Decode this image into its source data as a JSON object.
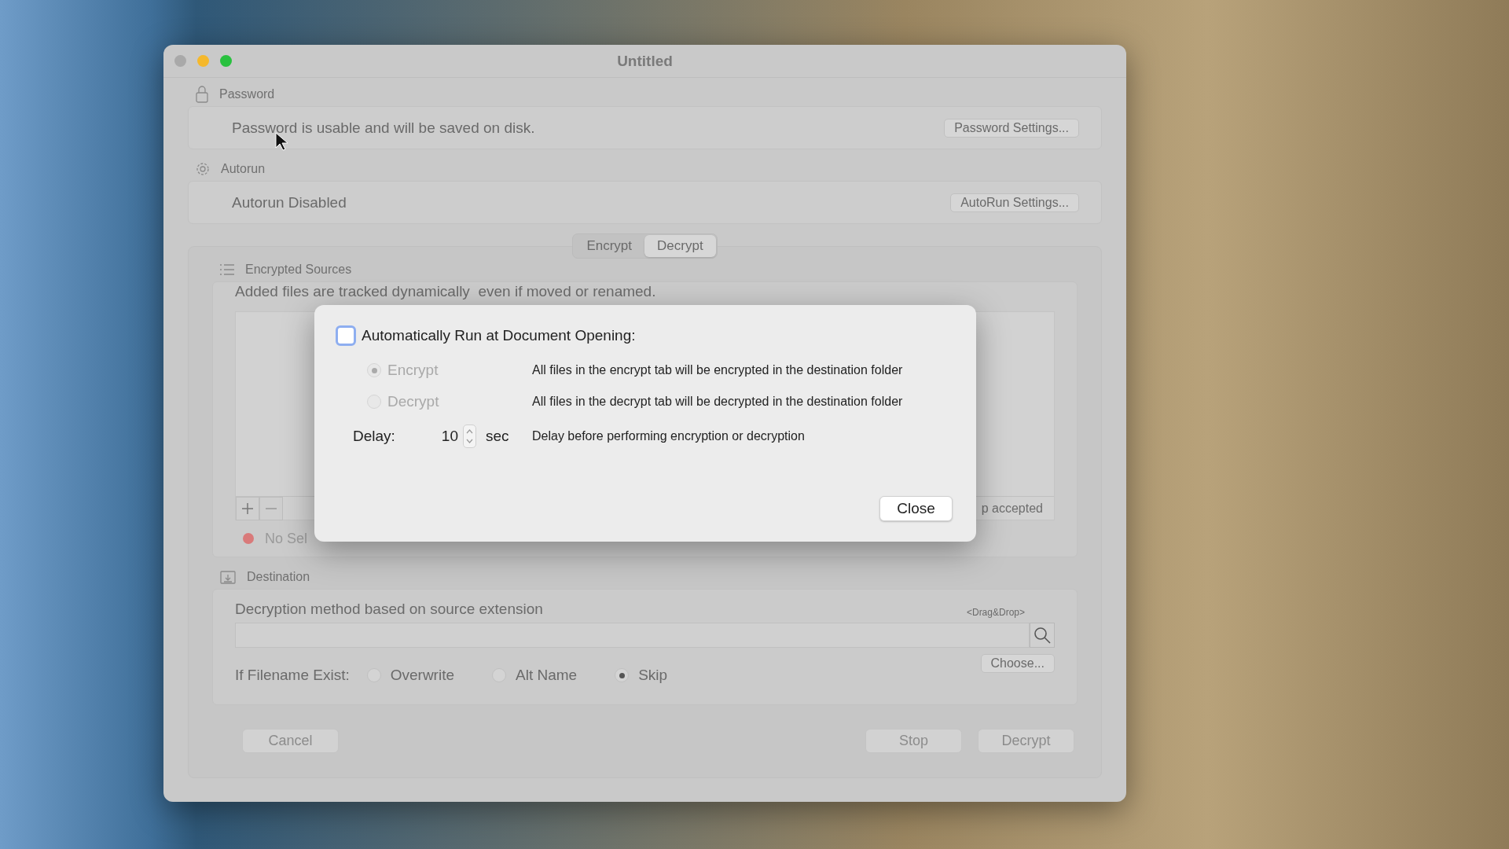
{
  "window": {
    "title": "Untitled"
  },
  "password": {
    "header": "Password",
    "message": "Password is usable and will be saved on disk.",
    "button": "Password Settings..."
  },
  "autorun": {
    "header": "Autorun",
    "message": "Autorun Disabled",
    "button": "AutoRun Settings..."
  },
  "tabs": [
    {
      "label": "Encrypt",
      "selected": false
    },
    {
      "label": "Decrypt",
      "selected": true
    }
  ],
  "sources": {
    "header": "Encrypted Sources",
    "note": "Added files are tracked dynamically  even if moved or renamed.",
    "footer_hint": "p accepted",
    "status": "No Sel"
  },
  "destination": {
    "header": "Destination",
    "method": "Decryption method based on source extension",
    "drop_hint": "<Drag&Drop>",
    "exists_label": "If Filename Exist:",
    "exists_options": [
      {
        "label": "Overwrite",
        "selected": false
      },
      {
        "label": "Alt Name",
        "selected": false
      },
      {
        "label": "Skip",
        "selected": true
      }
    ],
    "choose_button": "Choose..."
  },
  "actions": [
    {
      "label": "Cancel",
      "disabled": true
    },
    {
      "label": "Stop",
      "disabled": true
    },
    {
      "label": "Decrypt",
      "disabled": true
    }
  ],
  "dialog": {
    "checkbox": {
      "label": "Automatically Run at Document Opening:",
      "checked": false
    },
    "modes": [
      {
        "label": "Encrypt",
        "selected": true,
        "disabled": true,
        "description": "All files in the encrypt tab will be encrypted in the destination folder"
      },
      {
        "label": "Decrypt",
        "selected": false,
        "disabled": true,
        "description": "All files in the decrypt tab will be decrypted in the destination folder"
      }
    ],
    "delay": {
      "label": "Delay:",
      "value": "10",
      "unit": "sec",
      "description": "Delay before performing encryption or decryption"
    },
    "close_button": "Close"
  }
}
